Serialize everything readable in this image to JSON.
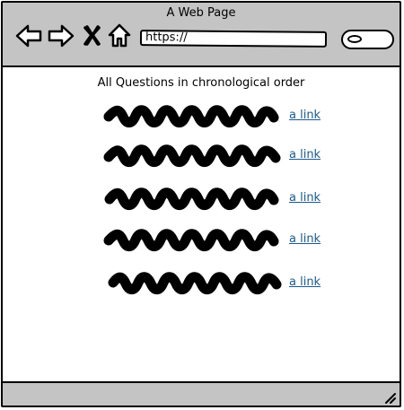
{
  "window": {
    "title": "A Web Page"
  },
  "toolbar": {
    "back_icon": "arrow-left-icon",
    "forward_icon": "arrow-right-icon",
    "stop_icon": "close-icon",
    "home_icon": "home-icon",
    "url": "https://",
    "search_icon": "search-icon"
  },
  "main": {
    "heading": "All Questions in chronological order",
    "items": [
      {
        "link_label": "a link"
      },
      {
        "link_label": "a link"
      },
      {
        "link_label": "a link"
      },
      {
        "link_label": "a link"
      },
      {
        "link_label": "a link"
      }
    ]
  },
  "colors": {
    "chrome": "#c4c4c4",
    "link": "#1a5a8c",
    "scribble": "#000000"
  }
}
